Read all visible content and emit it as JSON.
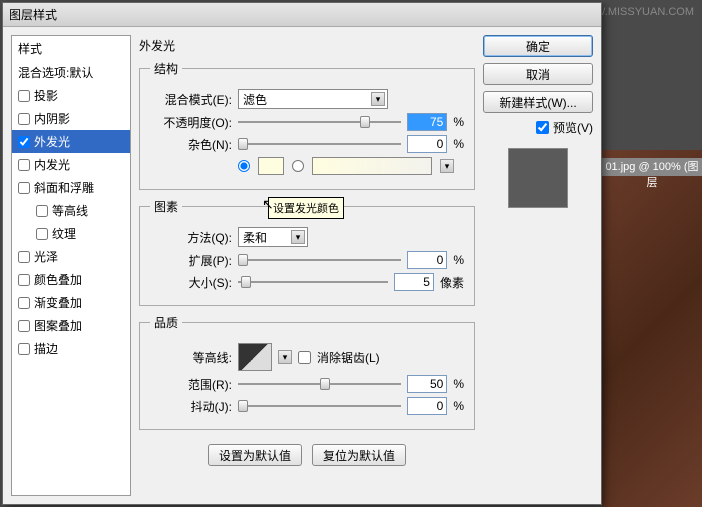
{
  "watermark": "思缘设计论坛  WWW.MISSYUAN.COM",
  "bg_filename": "01.jpg @ 100% (图层",
  "dialog_title": "图层样式",
  "sidebar": {
    "header": "样式",
    "blending": "混合选项:默认",
    "items": [
      {
        "label": "投影",
        "checked": false
      },
      {
        "label": "内阴影",
        "checked": false
      },
      {
        "label": "外发光",
        "checked": true,
        "selected": true
      },
      {
        "label": "内发光",
        "checked": false
      },
      {
        "label": "斜面和浮雕",
        "checked": false
      },
      {
        "label": "等高线",
        "checked": false,
        "indent": true
      },
      {
        "label": "纹理",
        "checked": false,
        "indent": true
      },
      {
        "label": "光泽",
        "checked": false
      },
      {
        "label": "颜色叠加",
        "checked": false
      },
      {
        "label": "渐变叠加",
        "checked": false
      },
      {
        "label": "图案叠加",
        "checked": false
      },
      {
        "label": "描边",
        "checked": false
      }
    ]
  },
  "main": {
    "title": "外发光",
    "structure": {
      "legend": "结构",
      "blend_mode_label": "混合模式(E):",
      "blend_mode_value": "滤色",
      "opacity_label": "不透明度(O):",
      "opacity_value": "75",
      "pct": "%",
      "noise_label": "杂色(N):",
      "noise_value": "0",
      "tooltip": "设置发光颜色"
    },
    "elements": {
      "legend": "图素",
      "technique_label": "方法(Q):",
      "technique_value": "柔和",
      "spread_label": "扩展(P):",
      "spread_value": "0",
      "size_label": "大小(S):",
      "size_value": "5",
      "pct": "%",
      "px": "像素"
    },
    "quality": {
      "legend": "品质",
      "contour_label": "等高线:",
      "antialias_label": "消除锯齿(L)",
      "range_label": "范围(R):",
      "range_value": "50",
      "jitter_label": "抖动(J):",
      "jitter_value": "0",
      "pct": "%"
    },
    "buttons": {
      "set_default": "设置为默认值",
      "reset_default": "复位为默认值"
    }
  },
  "right": {
    "ok": "确定",
    "cancel": "取消",
    "new_style": "新建样式(W)...",
    "preview": "预览(V)"
  }
}
